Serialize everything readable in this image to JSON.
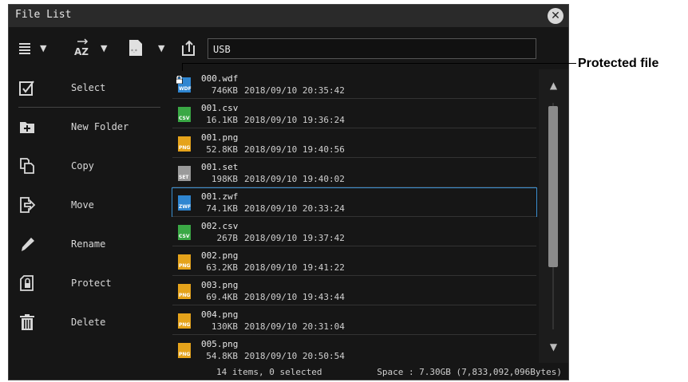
{
  "window": {
    "title": "File List",
    "close_icon": "close-icon"
  },
  "toolbar": {
    "view_icon": "list-view-icon",
    "sort_icon": "sort-az-icon",
    "filter_icon": "file-filter-icon",
    "up_icon": "up-folder-icon",
    "path": "USB"
  },
  "sidebar": {
    "items": [
      {
        "label": "Select",
        "icon": "checkbox-icon"
      },
      {
        "label": "New Folder",
        "icon": "new-folder-icon"
      },
      {
        "label": "Copy",
        "icon": "copy-icon"
      },
      {
        "label": "Move",
        "icon": "move-icon"
      },
      {
        "label": "Rename",
        "icon": "pencil-icon"
      },
      {
        "label": "Protect",
        "icon": "protect-icon"
      },
      {
        "label": "Delete",
        "icon": "trash-icon"
      }
    ]
  },
  "files": [
    {
      "name": "000.wdf",
      "size": "746KB",
      "date": "2018/09/10 20:35:42",
      "tag": "WDF",
      "color": "#2f86d1",
      "protected": true,
      "selected": false
    },
    {
      "name": "001.csv",
      "size": "16.1KB",
      "date": "2018/09/10 19:36:24",
      "tag": "CSV",
      "color": "#3aa845",
      "protected": false,
      "selected": false
    },
    {
      "name": "001.png",
      "size": "52.8KB",
      "date": "2018/09/10 19:40:56",
      "tag": "PNG",
      "color": "#e5a31b",
      "protected": false,
      "selected": false
    },
    {
      "name": "001.set",
      "size": "198KB",
      "date": "2018/09/10 19:40:02",
      "tag": "SET",
      "color": "#9a9a9a",
      "protected": false,
      "selected": false
    },
    {
      "name": "001.zwf",
      "size": "74.1KB",
      "date": "2018/09/10 20:33:24",
      "tag": "ZWF",
      "color": "#2f86d1",
      "protected": false,
      "selected": true
    },
    {
      "name": "002.csv",
      "size": "267B",
      "date": "2018/09/10 19:37:42",
      "tag": "CSV",
      "color": "#3aa845",
      "protected": false,
      "selected": false
    },
    {
      "name": "002.png",
      "size": "63.2KB",
      "date": "2018/09/10 19:41:22",
      "tag": "PNG",
      "color": "#e5a31b",
      "protected": false,
      "selected": false
    },
    {
      "name": "003.png",
      "size": "69.4KB",
      "date": "2018/09/10 19:43:44",
      "tag": "PNG",
      "color": "#e5a31b",
      "protected": false,
      "selected": false
    },
    {
      "name": "004.png",
      "size": "130KB",
      "date": "2018/09/10 20:31:04",
      "tag": "PNG",
      "color": "#e5a31b",
      "protected": false,
      "selected": false
    },
    {
      "name": "005.png",
      "size": "54.8KB",
      "date": "2018/09/10 20:50:54",
      "tag": "PNG",
      "color": "#e5a31b",
      "protected": false,
      "selected": false
    }
  ],
  "status": {
    "count": "14 items, 0 selected",
    "space": "Space : 7.30GB (7,833,092,096Bytes)"
  },
  "callout": {
    "label": "Protected file"
  },
  "colors": {
    "background": "#161616",
    "selection": "#3a8fd0",
    "text": "#e8e8e8"
  }
}
